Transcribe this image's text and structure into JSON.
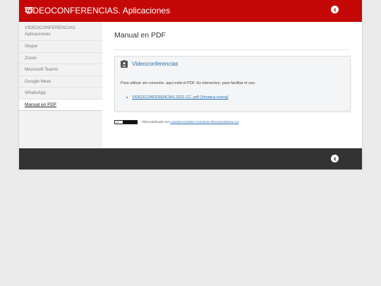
{
  "header": {
    "site_title": "VIDEOCONFERENCIAS. Aplicaciones"
  },
  "sidebar": {
    "items": [
      {
        "label": "VIDEOCONFERENCIAS Aplicaciones"
      },
      {
        "label": "Skype"
      },
      {
        "label": "Zoom"
      },
      {
        "label": "Microsoft Teams"
      },
      {
        "label": "Google Meet"
      },
      {
        "label": "WhatsApp"
      },
      {
        "label": "Manual en PDF"
      }
    ]
  },
  "main": {
    "page_title": "Manual en PDF",
    "card": {
      "title": "Videoconferencias",
      "text": "Para utilizar sin conexión, aquí está el PDF. Es interactivo, para facilitar el uso.",
      "link": "VIDEOCONFERENCIAS 2021 CC .pdf (Ventana nueva)"
    },
    "license": {
      "prefix": "Obra publicada con",
      "link": "Licencia Creative Commons Reconocimiento 4.0"
    }
  },
  "colors": {
    "header": "#c40808",
    "footer": "#333333",
    "link": "#2a6fb0"
  }
}
